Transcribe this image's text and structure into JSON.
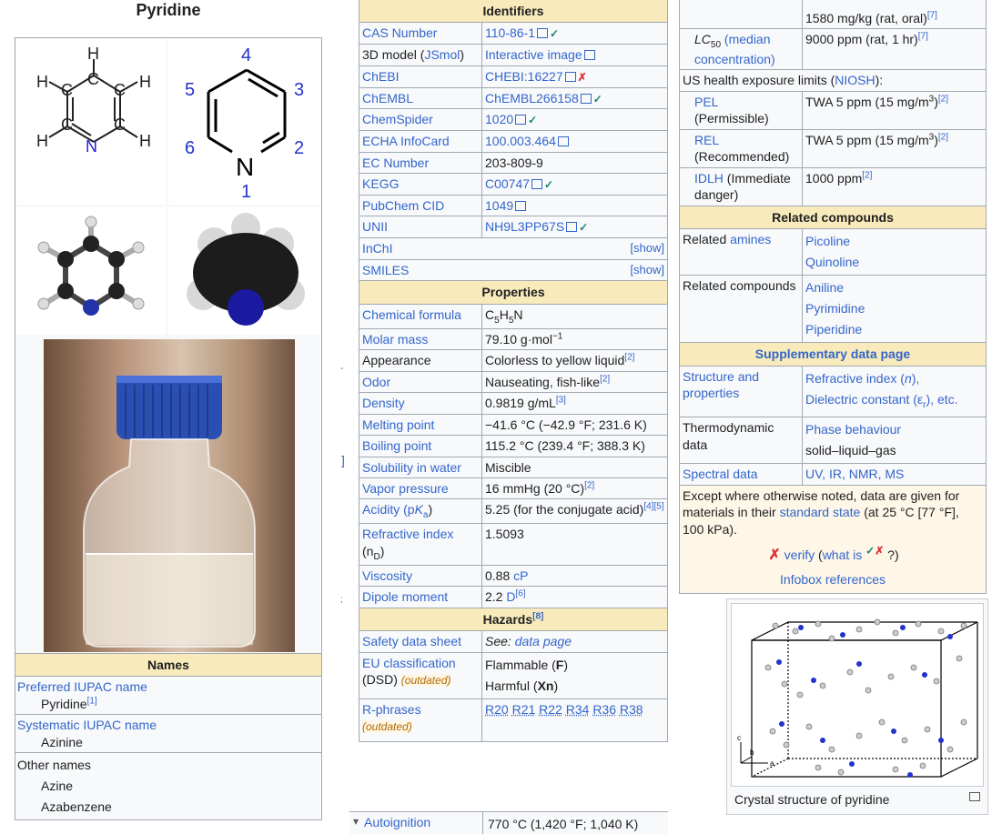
{
  "left": {
    "title": "Pyridine",
    "numbers": {
      "n1": "1",
      "n2": "2",
      "n3": "3",
      "n4": "4",
      "n5": "5",
      "n6": "6",
      "nlbl": "N"
    },
    "skeletal_atoms": {
      "h": "H",
      "c": "C",
      "n": "N"
    },
    "names_header": "Names",
    "preferred_label": "Preferred IUPAC name",
    "preferred_value": "Pyridine",
    "preferred_ref": "[1]",
    "systematic_label": "Systematic IUPAC name",
    "systematic_value": "Azinine",
    "other_label": "Other names",
    "other_values": [
      "Azine",
      "Azabenzene"
    ]
  },
  "identifiers": {
    "header": "Identifiers",
    "rows": [
      {
        "label": "CAS Number",
        "value": "110-86-1",
        "check": "✓"
      },
      {
        "label_pre": "3D model (",
        "label_link": "JSmol",
        "label_post": ")",
        "value": "Interactive image"
      },
      {
        "label": "ChEBI",
        "value": "CHEBI:16227",
        "cross": "✗"
      },
      {
        "label": "ChEMBL",
        "value": "ChEMBL266158",
        "check": "✓"
      },
      {
        "label": "ChemSpider",
        "value": "1020",
        "check": "✓"
      },
      {
        "label": "ECHA InfoCard",
        "value": "100.003.464"
      },
      {
        "label": "EC Number",
        "value": "203-809-9"
      },
      {
        "label": "KEGG",
        "value": "C00747",
        "check": "✓"
      },
      {
        "label": "PubChem CID",
        "value": "1049"
      },
      {
        "label": "UNII",
        "value": "NH9L3PP67S",
        "check": "✓"
      },
      {
        "label": "InChI",
        "show": "[show]"
      },
      {
        "label": "SMILES",
        "show": "[show]"
      }
    ]
  },
  "properties": {
    "header": "Properties",
    "formula_label": "Chemical formula",
    "formula": {
      "c": "C",
      "c_sub": "5",
      "h": "H",
      "h_sub": "5",
      "n": "N"
    },
    "molar_label": "Molar mass",
    "molar_value": "79.10 g·mol",
    "molar_exp": "−1",
    "appearance_label": "Appearance",
    "appearance_value": "Colorless to yellow liquid",
    "appearance_ref": "[2]",
    "odor_label": "Odor",
    "odor_value": "Nauseating, fish-like",
    "odor_ref": "[2]",
    "density_label": "Density",
    "density_value": "0.9819 g/mL",
    "density_ref": "[3]",
    "melting_label": "Melting point",
    "melting_value": "−41.6 °C (−42.9 °F; 231.6 K)",
    "boiling_label": "Boiling point",
    "boiling_value": "115.2 °C (239.4 °F; 388.3 K)",
    "solubility_label": "Solubility in water",
    "solubility_value": "Miscible",
    "vapor_label": "Vapor pressure",
    "vapor_value": "16 mmHg (20 °C)",
    "vapor_ref": "[2]",
    "acidity_label_pre": "Acidity (p",
    "acidity_label_k": "K",
    "acidity_label_a": "a",
    "acidity_label_post": ")",
    "acidity_value": "5.25 (for the conjugate acid)",
    "acidity_ref": "[4][5]",
    "refr_label": "Refractive index",
    "refr_label2_pre": "(n",
    "refr_label2_sub": "D",
    "refr_label2_post": ")",
    "refr_value": "1.5093",
    "visc_label": "Viscosity",
    "visc_value_num": "0.88 ",
    "visc_value_unit": "cP",
    "dipole_label": "Dipole moment",
    "dipole_value_num": "2.2 ",
    "dipole_value_unit": "D",
    "dipole_ref": "[6]"
  },
  "hazards": {
    "header": "Hazards",
    "header_ref": "[8]",
    "sds_label": "Safety data sheet",
    "sds_value_pre": "See: ",
    "sds_value_link": "data page",
    "eu_label1": "EU classification",
    "eu_label2": "(DSD) ",
    "eu_outdated": "(outdated)",
    "eu_value1_pre": "Flammable (",
    "eu_value1_b": "F",
    "eu_value1_post": ")",
    "eu_value2_pre": "Harmful (",
    "eu_value2_b": "Xn",
    "eu_value2_post": ")",
    "r_label": "R-phrases",
    "r_outdated": "(outdated)",
    "r_values": [
      "R20",
      "R21",
      "R22",
      "R34",
      "R36",
      "R38"
    ],
    "auto_label": "Autoignition",
    "auto_value": "770 °C (1,420 °F; 1,040 K)"
  },
  "right": {
    "tox_top_value": "1580 mg/kg (rat, oral)",
    "tox_top_ref": "[7]",
    "lc50_label_lc": "LC",
    "lc50_label_sub": "50",
    "lc50_label_link": "(median concentration)",
    "lc50_value": "9000 ppm (rat, 1 hr)",
    "lc50_ref": "[7]",
    "us_limits_pre": "US health exposure limits (",
    "us_limits_link": "NIOSH",
    "us_limits_post": "):",
    "pel_label": "PEL",
    "pel_sub": "(Permissible)",
    "pel_value_pre": "TWA 5 ppm (15 mg/m",
    "pel_value_exp": "3",
    "pel_value_post": ")",
    "pel_ref": "[2]",
    "rel_label": "REL",
    "rel_sub": "(Recommended)",
    "rel_value_pre": "TWA 5 ppm (15 mg/m",
    "rel_value_exp": "3",
    "rel_value_post": ")",
    "rel_ref": "[2]",
    "idlh_label": "IDLH",
    "idlh_label_post": " (Immediate danger)",
    "idlh_value": "1000 ppm",
    "idlh_ref": "[2]",
    "related_header": "Related compounds",
    "related_amines_pre": "Related ",
    "related_amines_link": "amines",
    "related_amines_values": [
      "Picoline",
      "Quinoline"
    ],
    "related_compounds_label": "Related compounds",
    "related_compounds_values": [
      "Aniline",
      "Pyrimidine",
      "Piperidine"
    ],
    "supp_header": "Supplementary data page",
    "struct_label": "Structure and properties",
    "struct_value1_pre": "Refractive index (",
    "struct_value1_n": "n",
    "struct_value1_post": "),",
    "struct_value2_pre": "Dielectric constant (ε",
    "struct_value2_sub": "r",
    "struct_value2_post": "), etc.",
    "thermo_label": "Thermodynamic data",
    "thermo_value1": "Phase behaviour",
    "thermo_value2": "solid–liquid–gas",
    "spectral_label": "Spectral data",
    "spectral_value": "UV, IR, NMR, MS",
    "except_text1": "Except where otherwise noted, data are given for materials in their ",
    "except_link": "standard state",
    "except_text2": " (at 25 °C [77 °F], 100 kPa).",
    "verify_cross": "✗",
    "verify_link": "verify",
    "verify_mid_pre": " (",
    "verify_mid_link": "what is",
    "verify_check": "✓",
    "verify_cross2": "✗",
    "verify_end": " ?)",
    "infobox_refs": "Infobox references",
    "crystal_caption": "Crystal structure of pyridine",
    "axis_labels": {
      "a": "a",
      "b": "b",
      "c": "c"
    }
  },
  "margin_glyphs": {
    "bracket": "]",
    "tick": ";",
    "dash": "-",
    "arrow": "▾"
  }
}
